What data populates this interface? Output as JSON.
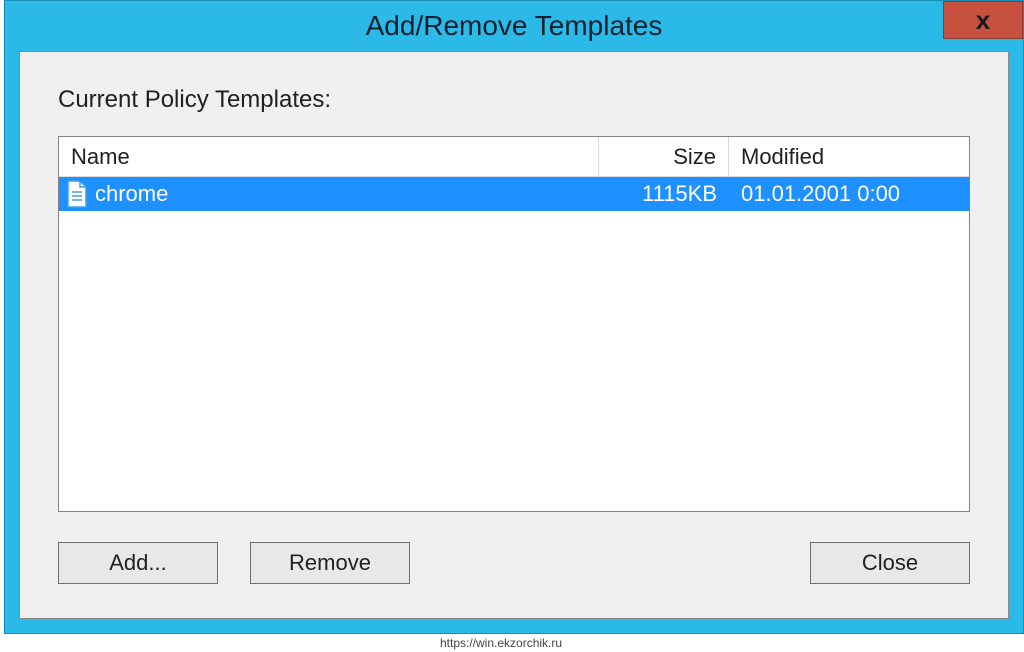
{
  "window": {
    "title": "Add/Remove Templates",
    "close_glyph": "x"
  },
  "section_label": "Current Policy Templates:",
  "columns": {
    "name": "Name",
    "size": "Size",
    "modified": "Modified"
  },
  "rows": [
    {
      "name": "chrome",
      "size": "1115KB",
      "modified": "01.01.2001 0:00",
      "selected": true
    }
  ],
  "buttons": {
    "add": "Add...",
    "remove": "Remove",
    "close": "Close"
  },
  "watermark": "https://win.ekzorchik.ru"
}
